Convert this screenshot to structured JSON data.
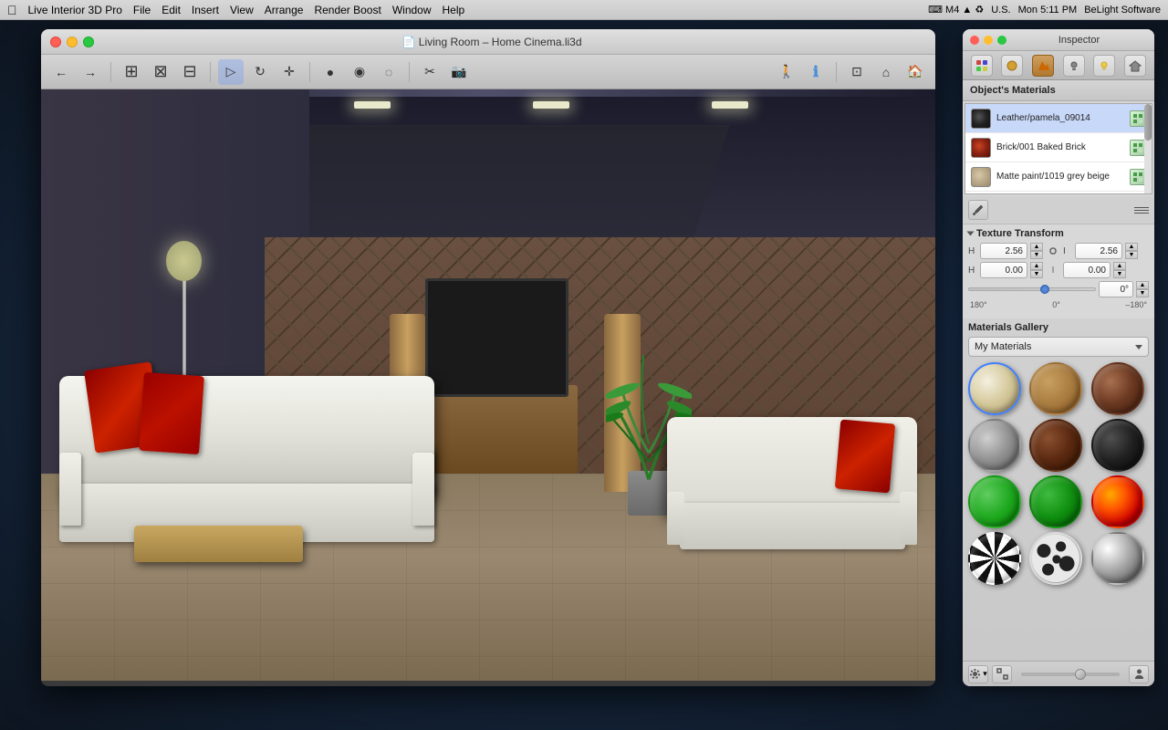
{
  "menubar": {
    "apple": "&#63743;",
    "items": [
      "Live Interior 3D Pro",
      "File",
      "Edit",
      "Insert",
      "View",
      "Arrange",
      "Render Boost",
      "Window",
      "Help"
    ],
    "right": {
      "time": "Mon 5:11 PM",
      "brand": "BeLight Software",
      "locale": "U.S."
    }
  },
  "window": {
    "title": "Living Room – Home Cinema.li3d",
    "close_label": "×",
    "min_label": "–",
    "max_label": "+"
  },
  "toolbar": {
    "nav_back": "←",
    "nav_fwd": "→",
    "btn_labels": [
      "⊞",
      "⊟",
      "⊠",
      "◉",
      "◎",
      "◌",
      "✂",
      "📷",
      "🏠",
      "ℹ",
      "⊡",
      "⌂",
      "🏠"
    ],
    "camera_icon": "📷"
  },
  "inspector": {
    "title": "Inspector",
    "tabs": [
      "materials-icon",
      "sphere-icon",
      "pencil-icon",
      "hat-icon",
      "bulb-icon",
      "house-icon"
    ],
    "tab_active": 2,
    "objects_materials_label": "Object's Materials",
    "materials": [
      {
        "name": "Leather/pamela_09014",
        "swatch_type": "dark-gray",
        "has_icon": true
      },
      {
        "name": "Brick/001 Baked Brick",
        "swatch_type": "red-brown",
        "has_icon": true
      },
      {
        "name": "Matte paint/1019 grey beige",
        "swatch_type": "beige",
        "has_icon": true
      }
    ],
    "texture_transform": {
      "label": "Texture Transform",
      "scale_x_label": "H",
      "scale_x_value": "2.56",
      "scale_y_label": "I",
      "scale_y_value": "2.56",
      "offset_x_label": "H",
      "offset_x_value": "0.00",
      "offset_y_label": "I",
      "offset_y_value": "0.00",
      "angle_value": "0°",
      "angle_min": "180°",
      "angle_mid": "0°",
      "angle_max": "–180°"
    },
    "gallery": {
      "label": "Materials Gallery",
      "dropdown_value": "My Materials",
      "materials": [
        {
          "type": "cream",
          "selected": true
        },
        {
          "type": "wood"
        },
        {
          "type": "darkwood"
        },
        {
          "type": "metal"
        },
        {
          "type": "brown"
        },
        {
          "type": "black"
        },
        {
          "type": "green"
        },
        {
          "type": "green2"
        },
        {
          "type": "fire"
        },
        {
          "type": "zebra"
        },
        {
          "type": "spots"
        },
        {
          "type": "chrome"
        }
      ]
    }
  }
}
